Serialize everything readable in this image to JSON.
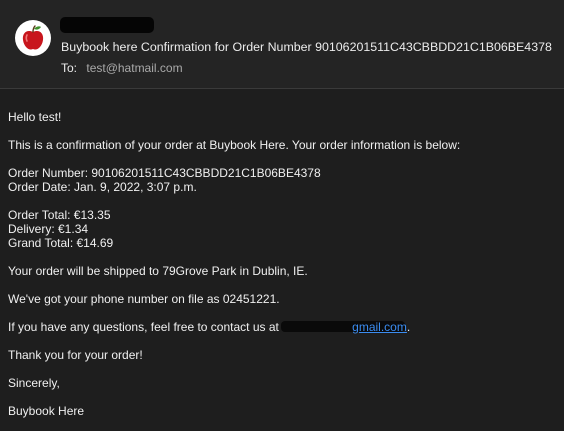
{
  "header": {
    "subject": "Buybook here Confirmation for Order Number 90106201511C43CBBDD21C1B06BE4378",
    "to_label": "To:",
    "to_value": "test@hatmail.com"
  },
  "body": {
    "greeting": "Hello test!",
    "intro": "This is a confirmation of your order at Buybook Here. Your order information is below:",
    "order_number": "Order Number: 90106201511C43CBBDD21C1B06BE4378",
    "order_date": "Order Date: Jan. 9, 2022, 3:07 p.m.",
    "order_total": "Order Total: €13.35",
    "delivery": "Delivery: €1.34",
    "grand_total": "Grand Total: €14.69",
    "shipping": "Your order will be shipped to 79Grove Park in Dublin, IE.",
    "phone": "We've got your phone number on file as 02451221.",
    "questions_prefix": "If you have any questions, feel free to contact us at ",
    "contact_email": "gmail.com",
    "questions_suffix": ".",
    "thanks": "Thank you for your order!",
    "closing": "Sincerely,",
    "signature": "Buybook Here"
  },
  "colors": {
    "background": "#1e1e1e",
    "header_background": "#242424",
    "link": "#3b8cf0",
    "avatar_apple": "#c8161d"
  },
  "icons": {
    "avatar": "apple-icon"
  }
}
